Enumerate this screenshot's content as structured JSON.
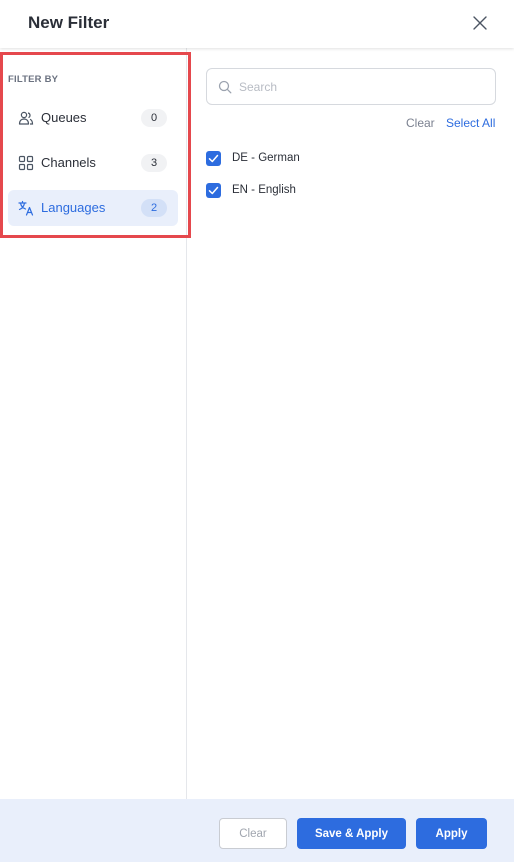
{
  "header": {
    "title": "New Filter",
    "close_icon": "close-icon"
  },
  "sidebar": {
    "section_label": "FILTER BY",
    "items": [
      {
        "label": "Queues",
        "count": "0",
        "icon": "users-icon",
        "active": false
      },
      {
        "label": "Channels",
        "count": "3",
        "icon": "grid-icon",
        "active": false
      },
      {
        "label": "Languages",
        "count": "2",
        "icon": "translate-icon",
        "active": true
      }
    ]
  },
  "main": {
    "search": {
      "placeholder": "Search",
      "value": ""
    },
    "clear_label": "Clear",
    "select_all_label": "Select All",
    "options": [
      {
        "label": "DE - German",
        "checked": true
      },
      {
        "label": "EN - English",
        "checked": true
      }
    ]
  },
  "footer": {
    "clear_label": "Clear",
    "save_apply_label": "Save & Apply",
    "apply_label": "Apply"
  },
  "colors": {
    "accent": "#2d6cdf",
    "highlight": "#e5484d",
    "footer_bg": "#e9effb"
  }
}
